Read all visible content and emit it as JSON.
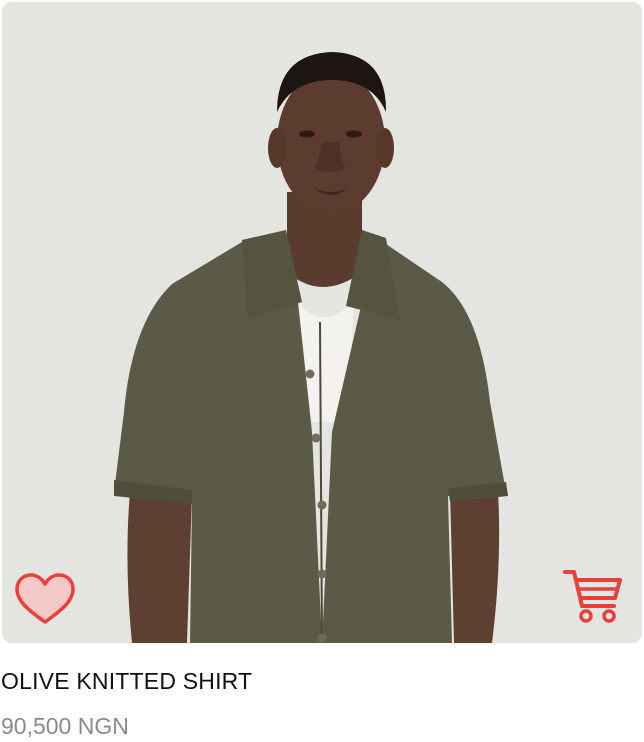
{
  "product": {
    "name": "OLIVE KNITTED SHIRT",
    "price": "90,500 NGN",
    "image_icon": "product-photo"
  },
  "actions": {
    "wishlist_icon": "heart-icon",
    "cart_icon": "cart-icon"
  },
  "colors": {
    "accent": "#e8403a",
    "heart_fill": "#f2c9c6",
    "image_bg": "#e3e3e0",
    "shirt": "#5b5a46",
    "price_text": "#8a8a8a"
  }
}
